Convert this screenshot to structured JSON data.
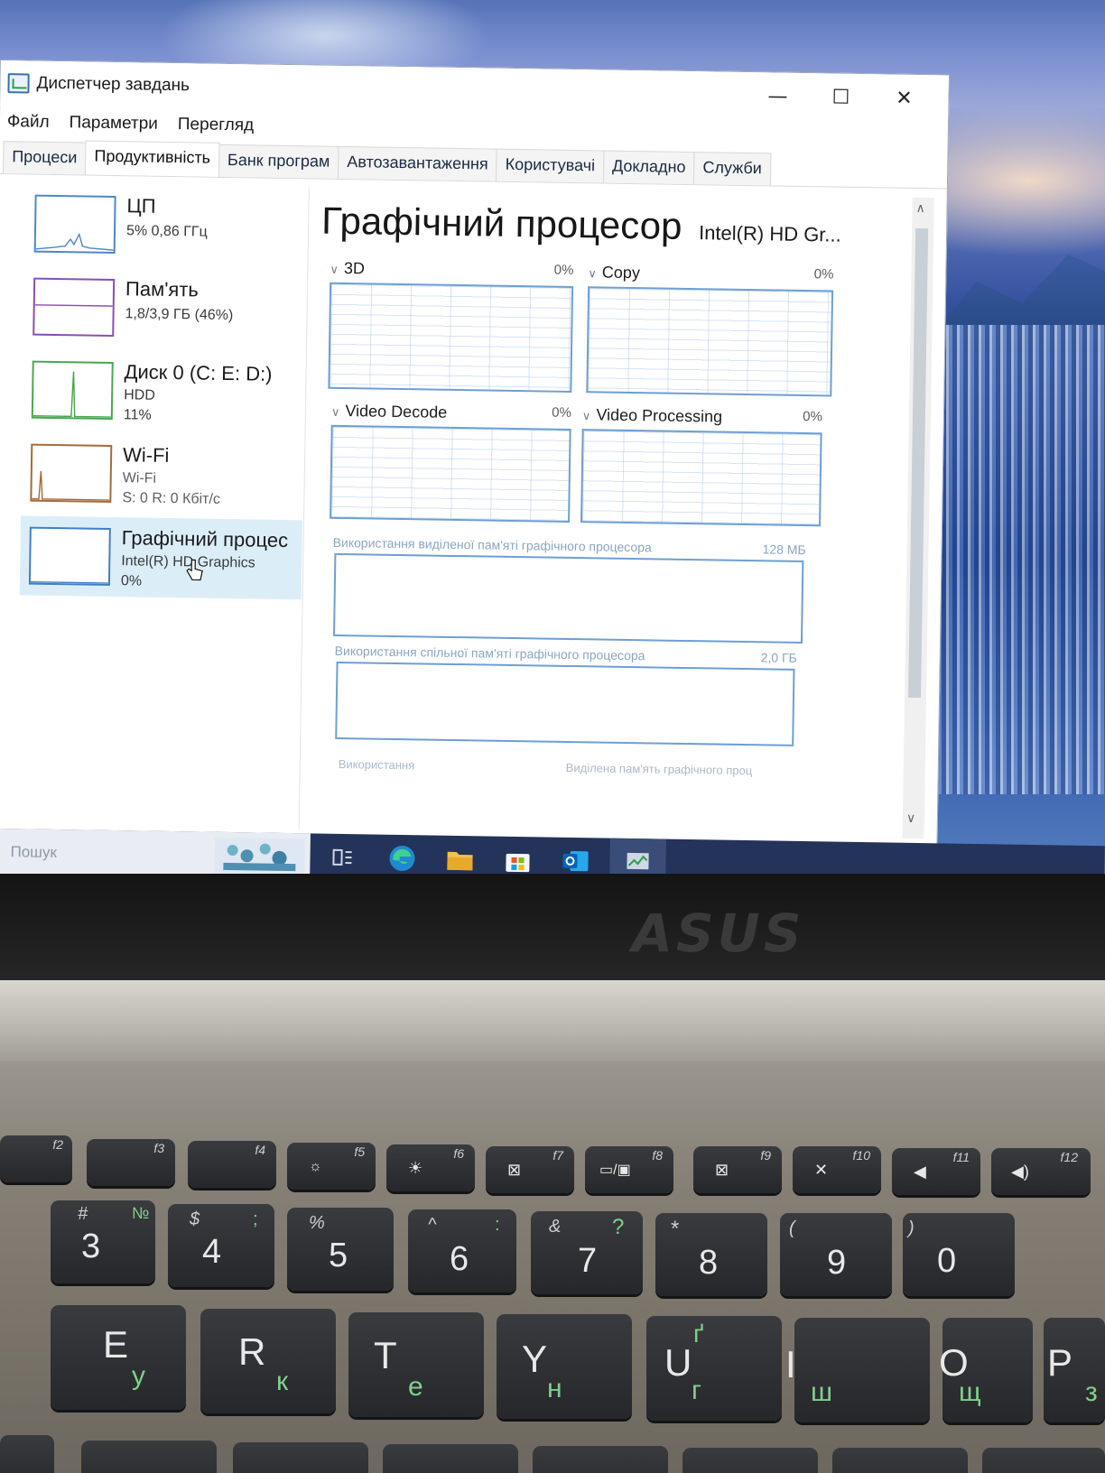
{
  "window": {
    "title": "Диспетчер завдань",
    "controls": {
      "minimize": "—",
      "maximize": "☐",
      "close": "✕"
    }
  },
  "menu": [
    "Файл",
    "Параметри",
    "Перегляд"
  ],
  "tabs": [
    "Процеси",
    "Продуктивність",
    "Банк програм",
    "Автозавантаження",
    "Користувачі",
    "Докладно",
    "Служби"
  ],
  "active_tab": "Продуктивність",
  "sidebar": [
    {
      "name": "ЦП",
      "line1": "5% 0,86 ГГц",
      "line2": ""
    },
    {
      "name": "Пам'ять",
      "line1": "1,8/3,9 ГБ (46%)",
      "line2": ""
    },
    {
      "name": "Диск 0 (C: E: D:)",
      "line1": "HDD",
      "line2": "11%"
    },
    {
      "name": "Wi-Fi",
      "line1": "Wi-Fi",
      "line2": "S: 0 R: 0 Кбіт/с"
    },
    {
      "name": "Графічний процес",
      "line1": "Intel(R) HD Graphics",
      "line2": "0%"
    }
  ],
  "gpu": {
    "title": "Графічний процесор",
    "device": "Intel(R) HD Gr...",
    "engines": [
      {
        "label": "3D",
        "percent": "0%"
      },
      {
        "label": "Copy",
        "percent": "0%"
      },
      {
        "label": "Video Decode",
        "percent": "0%"
      },
      {
        "label": "Video Processing",
        "percent": "0%"
      }
    ],
    "dedicated_label": "Використання виділеної пам'яті графічного процесора",
    "dedicated_value": "128 МБ",
    "shared_label": "Використання спільної пам'яті графічного процесора",
    "shared_value": "2,0 ГБ",
    "bottom_left": "Використання",
    "bottom_right": "Виділена пам'ять графічного проц"
  },
  "taskbar": {
    "search_placeholder": "Пошук",
    "icons": [
      "task-view-icon",
      "edge-icon",
      "file-explorer-icon",
      "store-icon",
      "outlook-icon",
      "task-manager-icon"
    ]
  },
  "laptop": {
    "brand": "ASUS",
    "fn_keys": [
      "f2",
      "f3",
      "f4",
      "f5",
      "f6",
      "f7",
      "f8",
      "f9",
      "f10",
      "f11",
      "f12"
    ],
    "number_keys": [
      {
        "main": "3",
        "shift": "#",
        "alt": "№"
      },
      {
        "main": "4",
        "shift": "$",
        "alt": ";"
      },
      {
        "main": "5",
        "shift": "%",
        "alt": ""
      },
      {
        "main": "6",
        "shift": "^",
        "alt": ":"
      },
      {
        "main": "7",
        "shift": "&",
        "alt": "?"
      },
      {
        "main": "8",
        "shift": "*",
        "alt": ""
      },
      {
        "main": "9",
        "shift": "(",
        "alt": ""
      },
      {
        "main": "0",
        "shift": ")",
        "alt": ""
      }
    ],
    "letter_keys": [
      {
        "main": "E",
        "alt": "у"
      },
      {
        "main": "R",
        "alt": "к"
      },
      {
        "main": "T",
        "alt": "е"
      },
      {
        "main": "Y",
        "alt": "н"
      },
      {
        "main": "U",
        "alt": "г",
        "alt2": "ґ"
      },
      {
        "main": "I",
        "alt": "ш"
      },
      {
        "main": "O",
        "alt": "щ"
      },
      {
        "main": "P",
        "alt": "з"
      }
    ]
  }
}
